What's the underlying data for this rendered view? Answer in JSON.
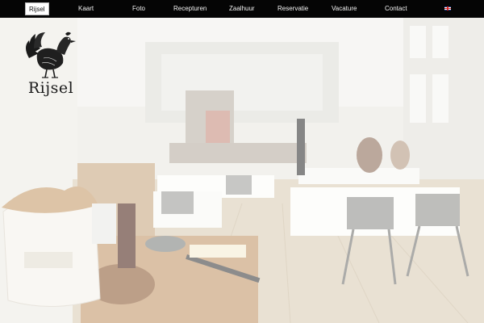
{
  "nav": {
    "brand": "Rijsel",
    "items": [
      {
        "label": "Kaart",
        "key": "kaart"
      },
      {
        "label": "Foto",
        "key": "foto"
      },
      {
        "label": "Recepturen",
        "key": "recepturen"
      },
      {
        "label": "Zaalhuur",
        "key": "zaalhuur"
      },
      {
        "label": "Reservatie",
        "key": "reservatie"
      },
      {
        "label": "Vacature",
        "key": "vacature"
      },
      {
        "label": "Contact",
        "key": "contact"
      }
    ],
    "language_icon": "english-flag-icon"
  },
  "logo": {
    "wordmark": "Rijsel",
    "icon": "rooster-icon"
  },
  "hero": {
    "icon": "restaurant-interior-photo"
  },
  "colors": {
    "nav_bg": "#050505",
    "nav_text": "#f4f4f4",
    "logo_ink": "#1a1a1a",
    "flag_blue": "#1f3a8a",
    "flag_red": "#d62828"
  }
}
